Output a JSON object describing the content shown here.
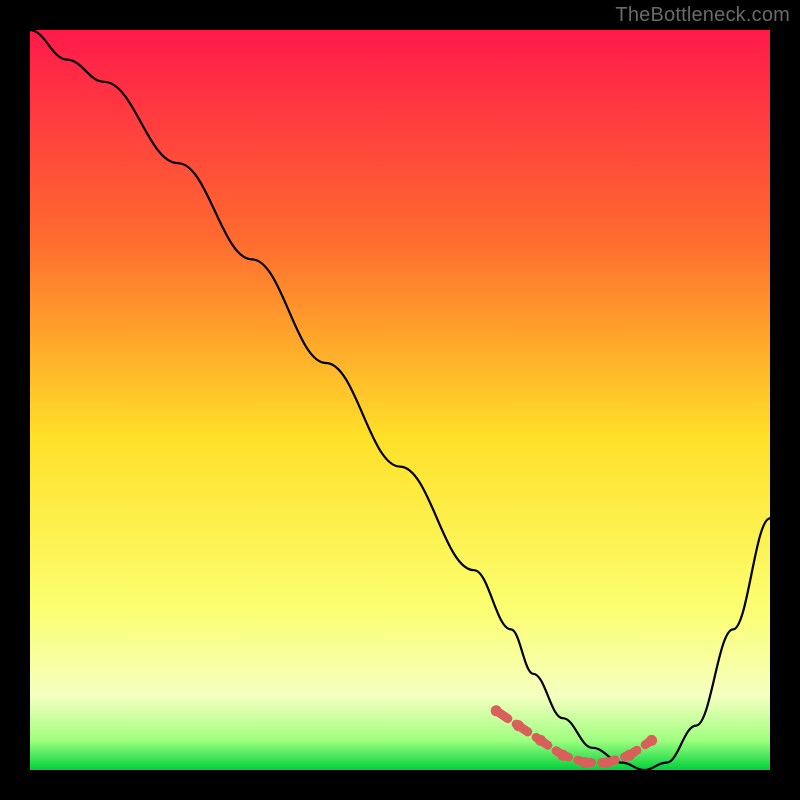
{
  "watermark": "TheBottleneck.com",
  "colors": {
    "bg": "#000000",
    "curve": "#000000",
    "marker": "#d9605a",
    "gradient_top": "#ff1a4b",
    "gradient_mid1": "#ff8a2a",
    "gradient_mid2": "#ffe028",
    "gradient_mid3": "#fbff70",
    "gradient_bottom": "#00d13c"
  },
  "chart_data": {
    "type": "line",
    "title": "",
    "xlabel": "",
    "ylabel": "",
    "xlim": [
      0,
      100
    ],
    "ylim": [
      0,
      100
    ],
    "series": [
      {
        "name": "bottleneck-curve",
        "x": [
          0,
          5,
          10,
          20,
          30,
          40,
          50,
          60,
          65,
          68,
          72,
          76,
          80,
          83,
          86,
          90,
          95,
          100
        ],
        "values": [
          100,
          96,
          93,
          82,
          69,
          55,
          41,
          27,
          19,
          13,
          7,
          3,
          1,
          0,
          1,
          6,
          19,
          34
        ]
      }
    ],
    "markers": {
      "name": "highlight-range",
      "x": [
        63,
        66,
        69,
        72,
        75,
        78,
        81,
        84
      ],
      "values": [
        8,
        6,
        4,
        2,
        1,
        1,
        2,
        4
      ]
    }
  }
}
